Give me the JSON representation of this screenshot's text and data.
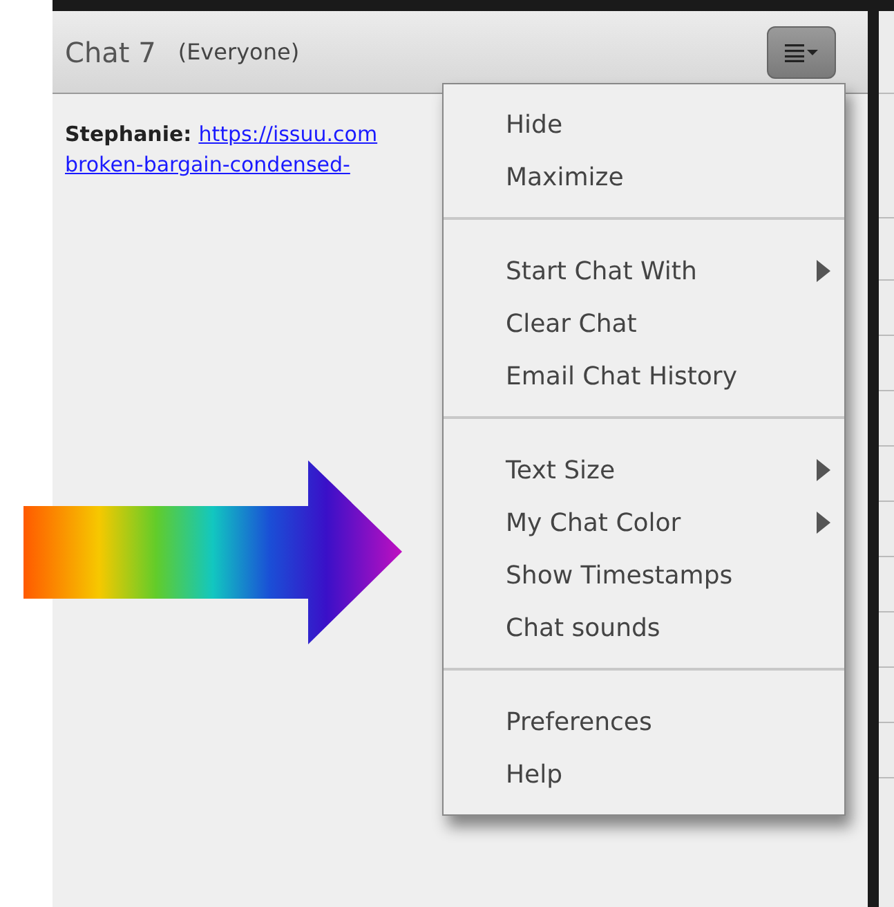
{
  "panel": {
    "title": "Chat 7",
    "audience": "(Everyone)"
  },
  "message": {
    "sender": "Stephanie:",
    "link_lines": [
      "https://issuu.com",
      "broken-bargain-condensed-"
    ]
  },
  "menu": {
    "groups": [
      {
        "items": [
          {
            "label": "Hide",
            "submenu": false
          },
          {
            "label": "Maximize",
            "submenu": false
          }
        ]
      },
      {
        "items": [
          {
            "label": "Start Chat With",
            "submenu": true
          },
          {
            "label": "Clear Chat",
            "submenu": false
          },
          {
            "label": "Email Chat History",
            "submenu": false
          }
        ]
      },
      {
        "items": [
          {
            "label": "Text Size",
            "submenu": true
          },
          {
            "label": "My Chat Color",
            "submenu": true
          },
          {
            "label": "Show Timestamps",
            "submenu": false
          },
          {
            "label": "Chat sounds",
            "submenu": false
          }
        ]
      },
      {
        "items": [
          {
            "label": "Preferences",
            "submenu": false
          },
          {
            "label": "Help",
            "submenu": false
          }
        ]
      }
    ]
  }
}
